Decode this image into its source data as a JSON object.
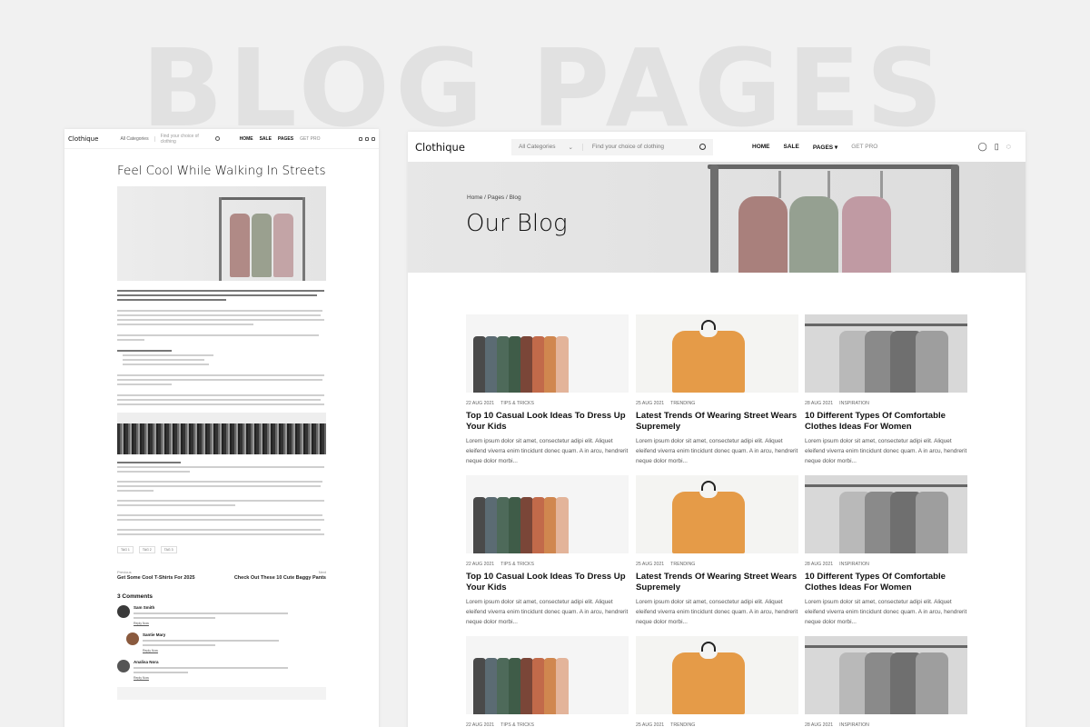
{
  "hero_title": "BLOG PAGES",
  "left": {
    "logo": "Clothique",
    "category_label": "All Categories",
    "search_placeholder": "Find your choice of clothing",
    "nav": [
      "HOME",
      "SALE",
      "PAGES",
      "GET PRO"
    ],
    "post_title": "Feel Cool While Walking In Streets",
    "tags": [
      "TAG 1",
      "TAG 2",
      "TAG 3"
    ],
    "prev_label": "Previous",
    "prev_title": "Get Some Cool T-Shirts For 2025",
    "next_label": "Next",
    "next_title": "Check Out These 10 Cute Baggy Pants",
    "comments_heading": "3 Comments",
    "comments": [
      {
        "name": "Sam Smith",
        "reply": "Reply Now"
      },
      {
        "name": "Santie Mary",
        "reply": "Reply Now"
      },
      {
        "name": "Analisa Nora",
        "reply": "Reply Now"
      }
    ]
  },
  "right": {
    "logo": "Clothique",
    "category_label": "All Categories",
    "search_placeholder": "Find your choice of clothing",
    "nav": {
      "home": "HOME",
      "sale": "SALE",
      "pages": "PAGES ▾",
      "pro": "GET PRO"
    },
    "breadcrumb": "Home  /  Pages  /  Blog",
    "banner_title": "Our Blog",
    "cards": [
      {
        "image": "colorful-shirts-rack",
        "date": "22 AUG 2021",
        "category": "TIPS & TRICKS",
        "title": "Top 10 Casual Look Ideas To Dress Up Your Kids",
        "excerpt": "Lorem ipsum dolor sit amet, consectetur adipi elit. Aliquet eleifend viverra enim tincidunt donec quam. A in arcu, hendrerit neque dolor morbi..."
      },
      {
        "image": "orange-tshirt-hanger",
        "date": "25 AUG 2021",
        "category": "TRENDING",
        "title": "Latest Trends Of Wearing Street Wears Supremely",
        "excerpt": "Lorem ipsum dolor sit amet, consectetur adipi elit. Aliquet eleifend viverra enim tincidunt donec quam. A in arcu, hendrerit neque dolor morbi..."
      },
      {
        "image": "gray-coats-rack",
        "date": "28 AUG 2021",
        "category": "INSPIRATION",
        "title": "10 Different Types Of Comfortable Clothes Ideas For Women",
        "excerpt": "Lorem ipsum dolor sit amet, consectetur adipi elit. Aliquet eleifend viverra enim tincidunt donec quam. A in arcu, hendrerit neque dolor morbi..."
      },
      {
        "image": "colorful-shirts-rack",
        "date": "22 AUG 2021",
        "category": "TIPS & TRICKS",
        "title": "Top 10 Casual Look Ideas To Dress Up Your Kids",
        "excerpt": "Lorem ipsum dolor sit amet, consectetur adipi elit. Aliquet eleifend viverra enim tincidunt donec quam. A in arcu, hendrerit neque dolor morbi..."
      },
      {
        "image": "orange-tshirt-hanger",
        "date": "25 AUG 2021",
        "category": "TRENDING",
        "title": "Latest Trends Of Wearing Street Wears Supremely",
        "excerpt": "Lorem ipsum dolor sit amet, consectetur adipi elit. Aliquet eleifend viverra enim tincidunt donec quam. A in arcu, hendrerit neque dolor morbi..."
      },
      {
        "image": "gray-coats-rack",
        "date": "28 AUG 2021",
        "category": "INSPIRATION",
        "title": "10 Different Types Of Comfortable Clothes Ideas For Women",
        "excerpt": "Lorem ipsum dolor sit amet, consectetur adipi elit. Aliquet eleifend viverra enim tincidunt donec quam. A in arcu, hendrerit neque dolor morbi..."
      },
      {
        "image": "colorful-shirts-rack",
        "date": "22 AUG 2021",
        "category": "TIPS & TRICKS",
        "title": "",
        "excerpt": ""
      },
      {
        "image": "orange-tshirt-hanger",
        "date": "25 AUG 2021",
        "category": "TRENDING",
        "title": "",
        "excerpt": ""
      },
      {
        "image": "gray-coats-rack",
        "date": "28 AUG 2021",
        "category": "INSPIRATION",
        "title": "",
        "excerpt": ""
      }
    ]
  },
  "colors": {
    "accent_orange": "#e59b48",
    "text": "#111111",
    "muted": "#666666"
  }
}
